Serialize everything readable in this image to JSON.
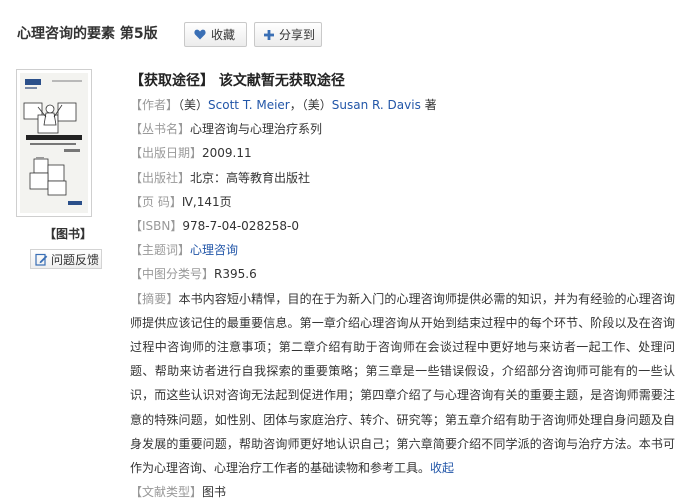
{
  "header": {
    "book_title": "心理咨询的要素 第5版",
    "fav_label": "收藏",
    "share_label": "分享到"
  },
  "cover": {
    "series_mark": "心理咨询与心理治疗系列",
    "cover_title": "心理咨询的要素",
    "tag": "【图书】",
    "feedback_label": "问题反馈"
  },
  "details": {
    "availability": "【获取途径】 该文献暂无获取途径",
    "author_label": "【作者】",
    "author_prefix1": "（美）",
    "author1": "Scott T. Meier",
    "author_sep": "，",
    "author_prefix2": "（美）",
    "author2": "Susan R. Davis",
    "author_suffix": " 著",
    "series_label": "【丛书名】",
    "series_value": "心理咨询与心理治疗系列",
    "date_label": "【出版日期】",
    "date_value": "2009.11",
    "publisher_label": "【出版社】",
    "publisher_value": "北京：高等教育出版社",
    "pages_label": "【页 码】",
    "pages_value": "Ⅳ,141页",
    "isbn_label": "【ISBN】",
    "isbn_value": "978-7-04-028258-0",
    "subject_label": "【主题词】",
    "subject_value": "心理咨询",
    "clc_label": "【中图分类号】",
    "clc_value": "R395.6",
    "abstract_label": "【摘要】",
    "abstract_value": "本书内容短小精悍，目的在于为新入门的心理咨询师提供必需的知识，并为有经验的心理咨询师提供应该记住的最重要信息。第一章介绍心理咨询从开始到结束过程中的每个环节、阶段以及在咨询过程中咨询师的注意事项；第二章介绍有助于咨询师在会谈过程中更好地与来访者一起工作、处理问题、帮助来访者进行自我探索的重要策略；第三章是一些错误假设，介绍部分咨询师可能有的一些认识，而这些认识对咨询无法起到促进作用；第四章介绍了与心理咨询有关的重要主题，是咨询师需要注意的特殊问题，如性别、团体与家庭治疗、转介、研究等；第五章介绍有助于咨询师处理自身问题及自身发展的重要问题，帮助咨询师更好地认识自己；第六章简要介绍不同学派的咨询与治疗方法。本书可作为心理咨询、心理治疗工作者的基础读物和参考工具。",
    "collapse_label": "收起",
    "doctype_label": "【文献类型】",
    "doctype_value": "图书"
  },
  "colors": {
    "label": "#999999",
    "link": "#2256a8",
    "heart": "#3a6fb5"
  }
}
